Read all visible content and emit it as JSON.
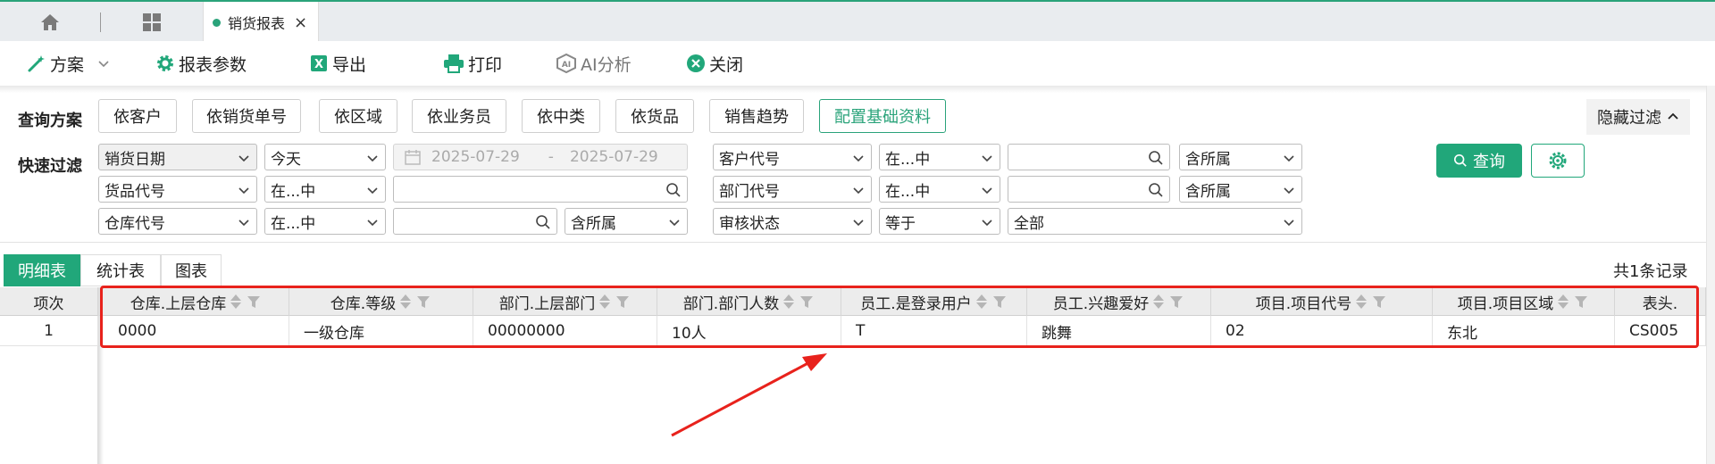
{
  "tabbar": {
    "active_tab": "销货报表",
    "close": "×"
  },
  "toolbar": {
    "scheme": "方案",
    "report_params": "报表参数",
    "export": "导出",
    "print": "打印",
    "ai_analysis": "AI分析",
    "close": "关闭"
  },
  "query": {
    "scheme_label": "查询方案",
    "schemes": [
      "依客户",
      "依销货单号",
      "依区域",
      "依业务员",
      "依中类",
      "依货品",
      "销售趋势"
    ],
    "config_button": "配置基础资料",
    "hide_filter": "隐藏过滤",
    "quick_filter_label": "快速过滤",
    "row1": {
      "field": "销货日期",
      "period": "今天",
      "date_from": "2025-07-29",
      "date_sep": "-",
      "date_to": "2025-07-29",
      "field2": "客户代号",
      "op2": "在...中",
      "inc2": "含所属"
    },
    "row2": {
      "field": "货品代号",
      "op": "在...中",
      "field2": "部门代号",
      "op2": "在...中",
      "inc2": "含所属"
    },
    "row3": {
      "field": "仓库代号",
      "op": "在...中",
      "inc": "含所属",
      "field2": "审核状态",
      "op2": "等于",
      "val2": "全部"
    },
    "query_button": "查询"
  },
  "view_tabs": [
    "明细表",
    "统计表",
    "图表"
  ],
  "record_count": "共1条记录",
  "table": {
    "index_header": "项次",
    "headers": [
      "仓库.上层仓库",
      "仓库.等级",
      "部门.上层部门",
      "部门.部门人数",
      "员工.是登录用户",
      "员工.兴趣爱好",
      "项目.项目代号",
      "项目.项目区域",
      "表头."
    ],
    "rows": [
      {
        "index": "1",
        "cells": [
          "0000",
          "一级仓库",
          "00000000",
          "10人",
          "T",
          "跳舞",
          "02",
          "东北",
          "CS005"
        ]
      }
    ]
  },
  "colors": {
    "accent": "#21a77a",
    "annotation": "#e8221c"
  }
}
